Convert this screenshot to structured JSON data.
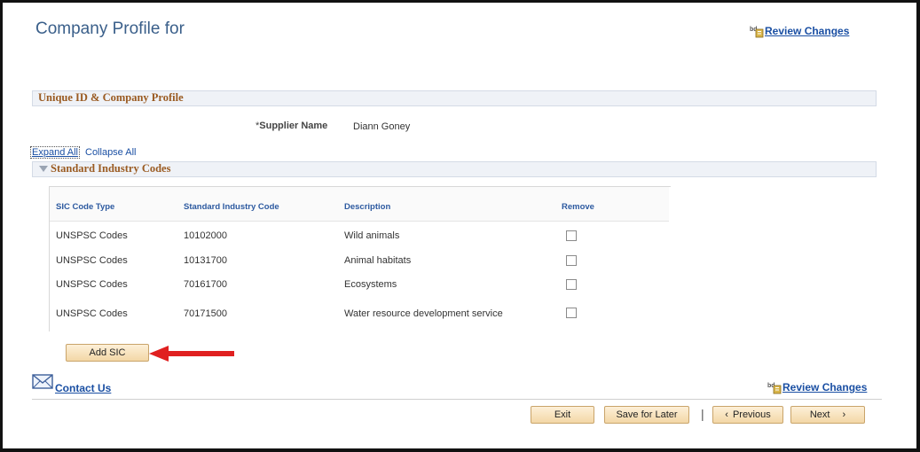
{
  "page": {
    "title": "Company Profile for",
    "review_changes_label": "Review Changes"
  },
  "section": {
    "title": "Unique ID & Company Profile"
  },
  "supplier": {
    "label": "Supplier Name",
    "required_marker": "*",
    "value": "Diann Goney"
  },
  "controls": {
    "expand_all": "Expand All",
    "collapse_all": "Collapse All"
  },
  "sic": {
    "group_title": "Standard Industry Codes",
    "headers": [
      "SIC Code Type",
      "Standard Industry Code",
      "Description",
      "Remove"
    ],
    "rows": [
      {
        "type": "UNSPSC Codes",
        "code": "10102000",
        "description": "Wild animals",
        "remove": false
      },
      {
        "type": "UNSPSC Codes",
        "code": "10131700",
        "description": "Animal habitats",
        "remove": false
      },
      {
        "type": "UNSPSC Codes",
        "code": "70161700",
        "description": "Ecosystems",
        "remove": false
      },
      {
        "type": "UNSPSC Codes",
        "code": "70171500",
        "description": "Water resource development service",
        "remove": false
      }
    ],
    "add_button": "Add SIC"
  },
  "footer": {
    "contact_us": "Contact Us",
    "review_changes_label": "Review Changes",
    "exit": "Exit",
    "save_for_later": "Save for Later",
    "previous": "Previous",
    "previous_glyph": "‹",
    "next": "Next",
    "next_glyph": "›"
  },
  "colors": {
    "title_blue": "#3a5f8a",
    "section_brown": "#9a5b22",
    "link_blue": "#1a4fa3",
    "arrow_red": "#e02020"
  },
  "icons": [
    "review-changes-icon",
    "triangle-down-icon",
    "contact-envelope-icon",
    "red-arrow-icon"
  ]
}
